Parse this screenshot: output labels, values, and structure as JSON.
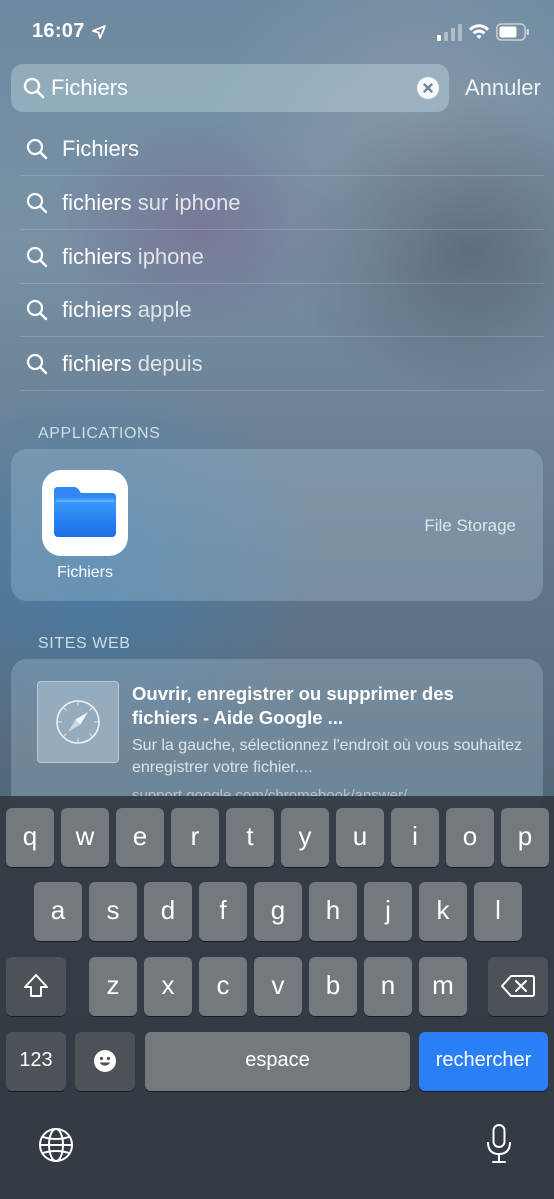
{
  "status": {
    "time": "16:07"
  },
  "search": {
    "value": "Fichiers",
    "cancel_label": "Annuler"
  },
  "suggestions": [
    {
      "bold": "Fichiers",
      "rest": ""
    },
    {
      "bold": "fichiers",
      "rest": " sur iphone"
    },
    {
      "bold": "fichiers",
      "rest": " iphone"
    },
    {
      "bold": "fichiers",
      "rest": " apple"
    },
    {
      "bold": "fichiers",
      "rest": " depuis"
    }
  ],
  "apps_section": {
    "title": "APPLICATIONS",
    "app_name": "Fichiers",
    "subtitle": "File Storage",
    "icon": "folder-icon"
  },
  "web_section": {
    "title": "SITES WEB",
    "result_title": "Ouvrir, enregistrer ou supprimer des fichiers - Aide Google ...",
    "result_desc": "Sur la gauche, sélectionnez l'endroit où vous souhaitez enregistrer votre fichier....",
    "result_url": "support.google.com/chromebook/answer/",
    "icon": "safari-compass-icon"
  },
  "keyboard": {
    "row1": [
      "q",
      "w",
      "e",
      "r",
      "t",
      "y",
      "u",
      "i",
      "o",
      "p"
    ],
    "row2": [
      "a",
      "s",
      "d",
      "f",
      "g",
      "h",
      "j",
      "k",
      "l"
    ],
    "row3": [
      "z",
      "x",
      "c",
      "v",
      "b",
      "n",
      "m"
    ],
    "numbers_label": "123",
    "space_label": "espace",
    "search_label": "rechercher",
    "accent_color": "#2a7ff6"
  }
}
